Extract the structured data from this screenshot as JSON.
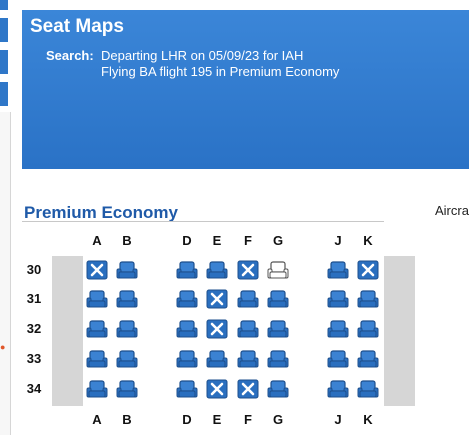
{
  "header": {
    "title": "Seat Maps",
    "search_label": "Search:",
    "search_line1": "Departing LHR on 05/09/23 for IAH",
    "search_line2": "Flying BA flight 195 in Premium Economy"
  },
  "cabin": {
    "title": "Premium Economy",
    "aircraft_label": "Aircra"
  },
  "seatmap": {
    "columns": [
      "A",
      "B",
      "D",
      "E",
      "F",
      "G",
      "J",
      "K"
    ],
    "rows": [
      {
        "number": "30",
        "seats": [
          "occupied",
          "available",
          "available",
          "available",
          "occupied",
          "selected",
          "available",
          "occupied"
        ]
      },
      {
        "number": "31",
        "seats": [
          "available",
          "available",
          "available",
          "occupied",
          "available",
          "available",
          "available",
          "available"
        ]
      },
      {
        "number": "32",
        "seats": [
          "available",
          "available",
          "available",
          "occupied",
          "available",
          "available",
          "available",
          "available"
        ]
      },
      {
        "number": "33",
        "seats": [
          "available",
          "available",
          "available",
          "available",
          "available",
          "available",
          "available",
          "available"
        ]
      },
      {
        "number": "34",
        "seats": [
          "available",
          "available",
          "available",
          "occupied",
          "occupied",
          "available",
          "available",
          "available"
        ]
      }
    ],
    "colors": {
      "seat_blue": "#2a6fbf",
      "seat_dark": "#1d4f8d",
      "selected_fill": "#ffffff",
      "selected_stroke": "#555555",
      "wall": "#d6d6d6"
    },
    "icons": {
      "available": "seat-icon",
      "occupied": "occupied-seat-icon",
      "selected": "selected-seat-icon"
    }
  }
}
